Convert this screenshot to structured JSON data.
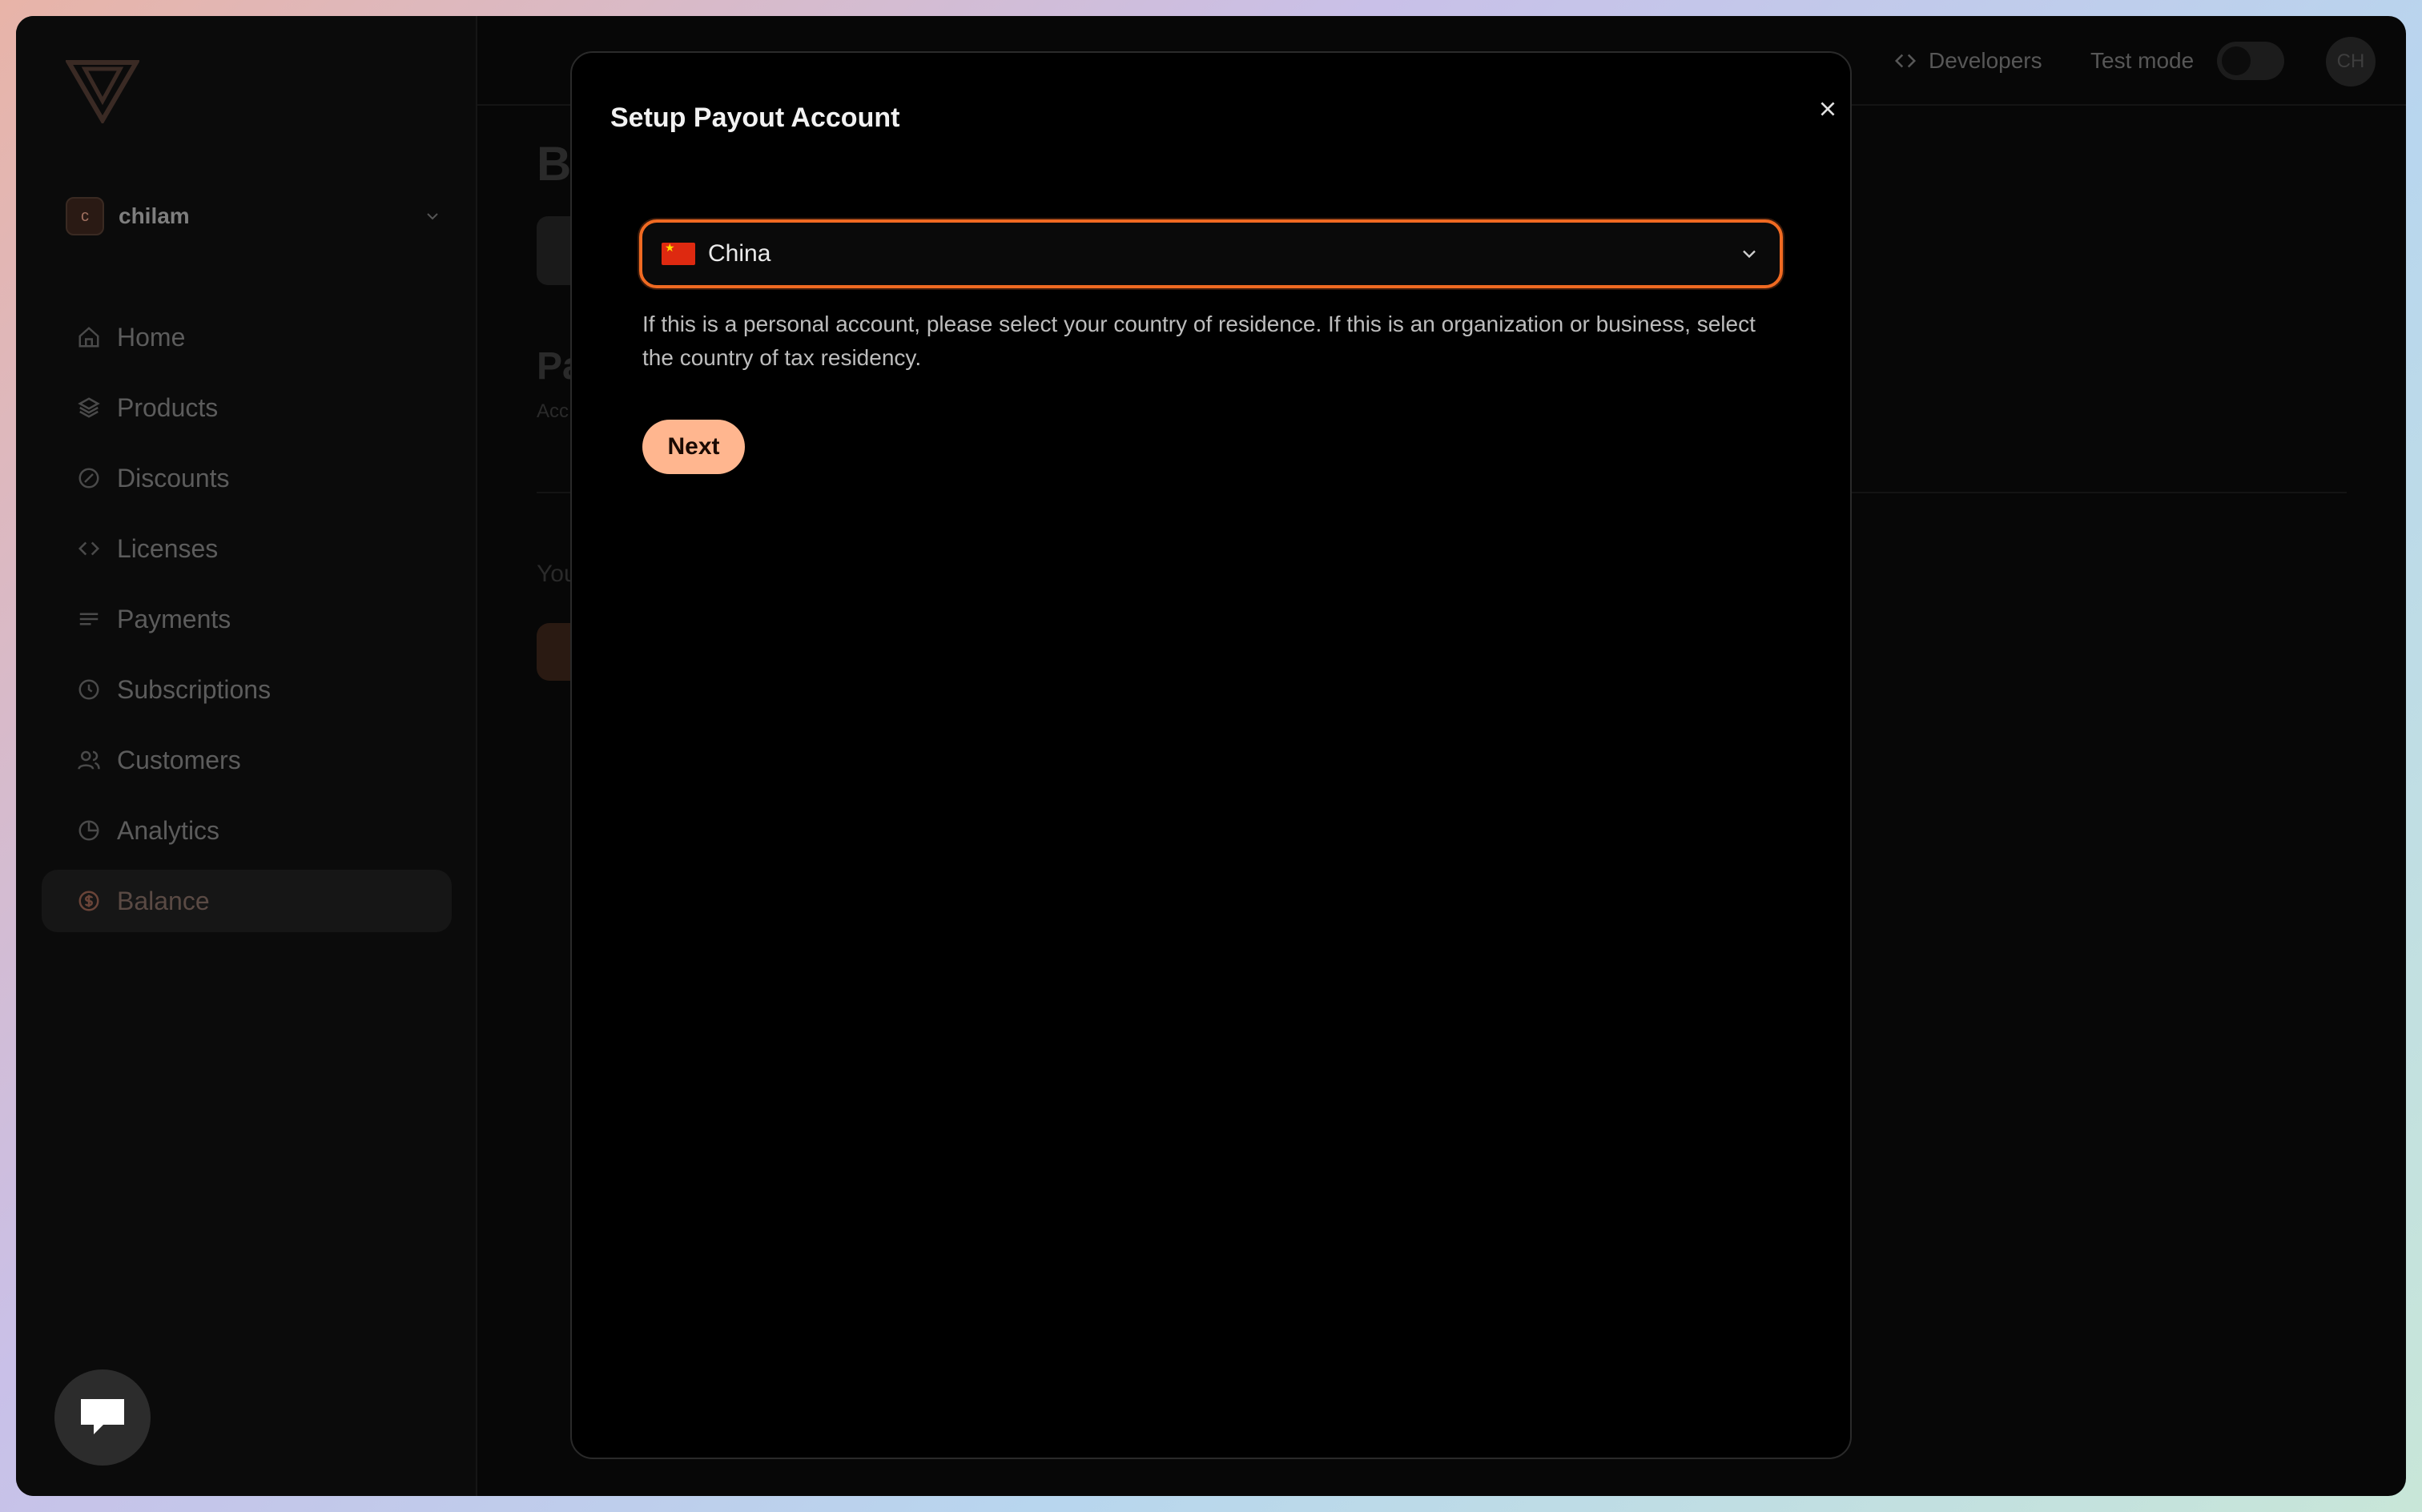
{
  "sidebar": {
    "org_initial": "c",
    "org_name": "chilam",
    "items": [
      {
        "label": "Home",
        "icon": "home-icon"
      },
      {
        "label": "Products",
        "icon": "layers-icon"
      },
      {
        "label": "Discounts",
        "icon": "discount-icon"
      },
      {
        "label": "Licenses",
        "icon": "code-icon"
      },
      {
        "label": "Payments",
        "icon": "payments-icon"
      },
      {
        "label": "Subscriptions",
        "icon": "clock-icon"
      },
      {
        "label": "Customers",
        "icon": "users-icon"
      },
      {
        "label": "Analytics",
        "icon": "pie-chart-icon"
      },
      {
        "label": "Balance",
        "icon": "dollar-circle-icon",
        "active": true
      }
    ]
  },
  "topbar": {
    "developers_label": "Developers",
    "test_mode_label": "Test mode",
    "test_mode_on": false,
    "user_initials": "CH"
  },
  "background": {
    "title_fragment": "B",
    "heading_fragment": "Pa",
    "subtext_fragment": "Acc",
    "body_fragment": "You"
  },
  "modal": {
    "title": "Setup Payout Account",
    "country_select": {
      "value": "China",
      "flag": "china-flag"
    },
    "helper_text": "If this is a personal account, please select your country of residence. If this is an organization or business, select the country of tax residency.",
    "next_label": "Next"
  },
  "colors": {
    "accent": "#f06a22",
    "next_button": "#ffb68f",
    "modal_bg": "#000000"
  }
}
